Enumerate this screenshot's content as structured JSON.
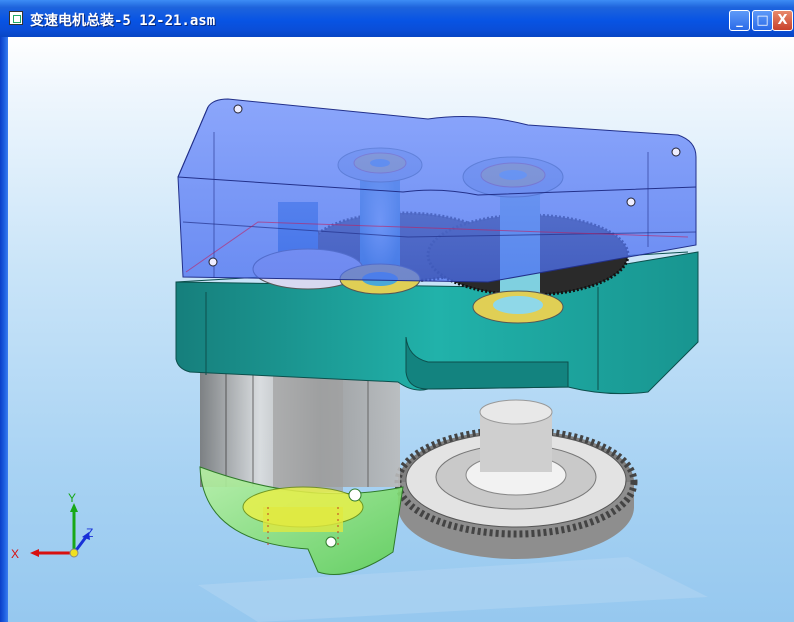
{
  "window": {
    "title": "变速电机总装-5 12-21.asm",
    "minimize_label": "_",
    "maximize_label": "□",
    "close_label": "X"
  },
  "triad": {
    "x_label": "X",
    "y_label": "Y",
    "z_label": "Z"
  },
  "colors": {
    "housing_top": "#6f8ff8",
    "housing_base": "#1fa7a0",
    "motor_cap": "#8fe07e",
    "gear": "#d9d9d9",
    "bearing": "#e0cf55"
  }
}
